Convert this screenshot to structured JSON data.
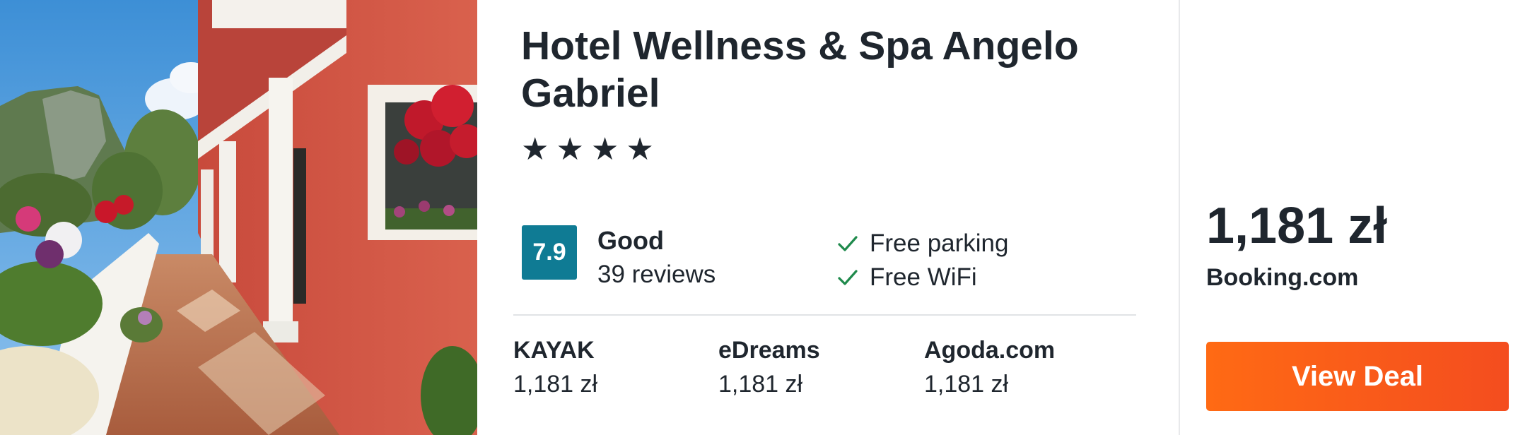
{
  "hotel": {
    "name": "Hotel Wellness & Spa Angelo Gabriel",
    "stars_text": "★★★★",
    "star_count": 4,
    "photo_icon": "hotel-photo"
  },
  "rating": {
    "score": "7.9",
    "label": "Good",
    "reviews": "39 reviews",
    "badge_color": "#0f7b94"
  },
  "amenities": [
    {
      "label": "Free parking",
      "icon": "check-icon"
    },
    {
      "label": "Free WiFi",
      "icon": "check-icon"
    }
  ],
  "providers": [
    {
      "name": "KAYAK",
      "price": "1,181 zł"
    },
    {
      "name": "eDreams",
      "price": "1,181 zł"
    },
    {
      "name": "Agoda.com",
      "price": "1,181 zł"
    }
  ],
  "best_deal": {
    "price": "1,181 zł",
    "provider": "Booking.com",
    "button_label": "View Deal",
    "button_color": "#ff6a14"
  }
}
